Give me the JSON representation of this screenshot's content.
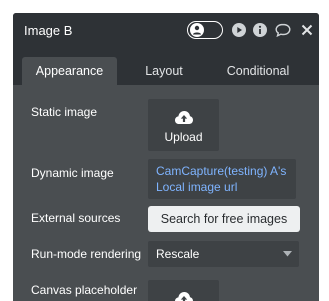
{
  "panel": {
    "title": "Image B",
    "title_icons": [
      "user-icon",
      "play-icon",
      "info-icon",
      "comment-icon",
      "close-icon"
    ]
  },
  "tabs": [
    {
      "label": "Appearance",
      "active": true
    },
    {
      "label": "Layout",
      "active": false
    },
    {
      "label": "Conditional",
      "active": false
    }
  ],
  "fields": {
    "static_image": {
      "label": "Static image",
      "button": "Upload"
    },
    "dynamic_image": {
      "label": "Dynamic image",
      "line1": "CamCapture(testing) A's",
      "line2": "Local image url"
    },
    "external_sources": {
      "label": "External sources",
      "button": "Search for free images"
    },
    "run_mode": {
      "label": "Run-mode rendering",
      "value": "Rescale"
    },
    "canvas_placeholder": {
      "label": "Canvas placeholder"
    }
  },
  "colors": {
    "panel_bg": "#4a4e51",
    "header_bg": "#2e3236",
    "field_bg": "#3e4245",
    "link_blue": "#7fb4ff"
  }
}
